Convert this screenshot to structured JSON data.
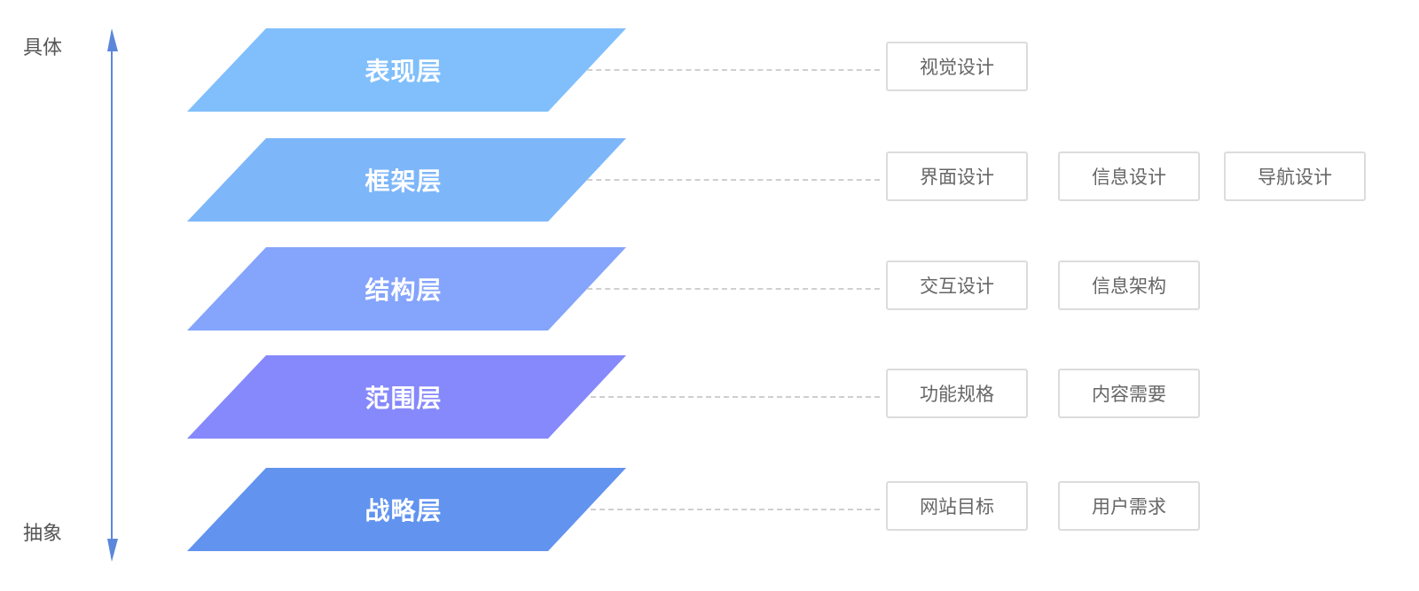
{
  "axis": {
    "top_label": "具体",
    "bottom_label": "抽象",
    "color": "#5b87db"
  },
  "layers": [
    {
      "name": "表现层",
      "color": "#80bffc",
      "items": [
        "视觉设计"
      ]
    },
    {
      "name": "框架层",
      "color": "#7db6f9",
      "items": [
        "界面设计",
        "信息设计",
        "导航设计"
      ]
    },
    {
      "name": "结构层",
      "color": "#85a4fc",
      "items": [
        "交互设计",
        "信息架构"
      ]
    },
    {
      "name": "范围层",
      "color": "#8689fb",
      "items": [
        "功能规格",
        "内容需要"
      ]
    },
    {
      "name": "战略层",
      "color": "#6193ef",
      "items": [
        "网站目标",
        "用户需求"
      ]
    }
  ]
}
